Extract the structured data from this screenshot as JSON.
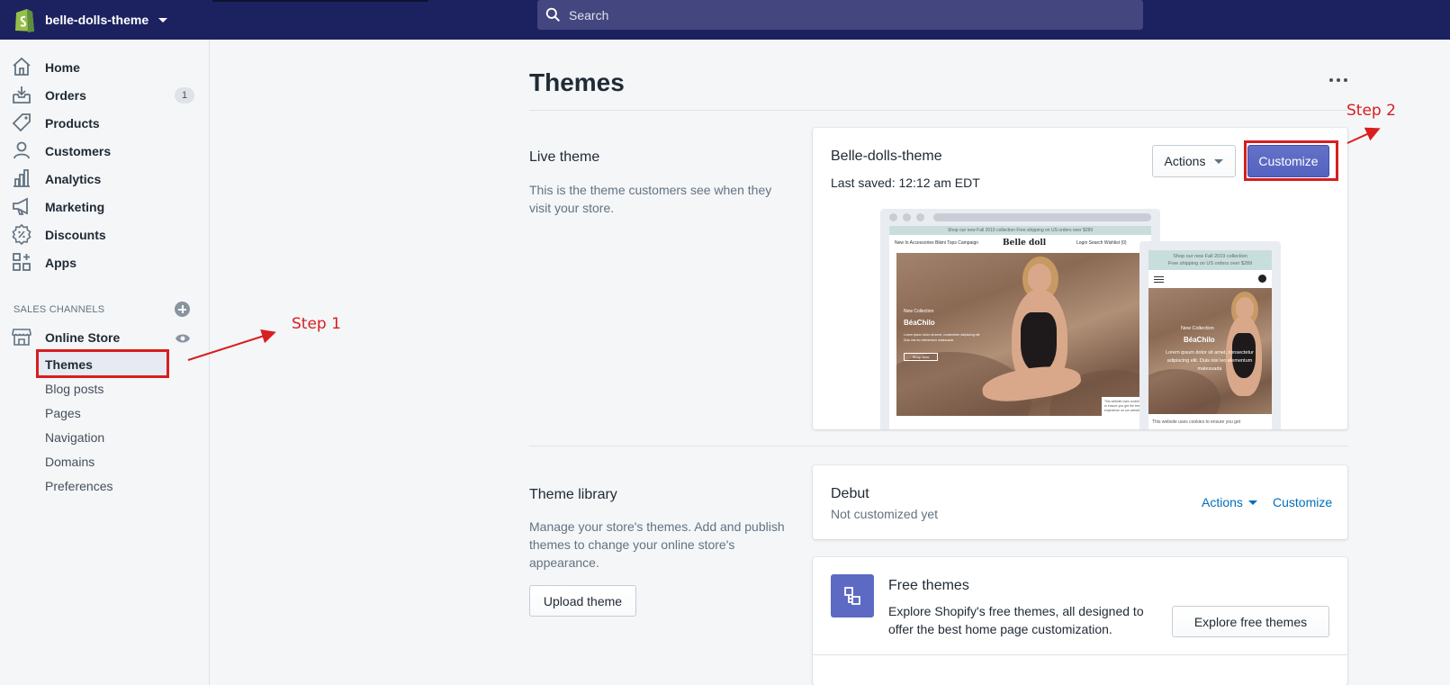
{
  "topbar": {
    "store_name": "belle-dolls-theme",
    "search_placeholder": "Search"
  },
  "sidebar": {
    "items": [
      {
        "label": "Home",
        "icon": "home-icon"
      },
      {
        "label": "Orders",
        "icon": "orders-icon",
        "badge": "1"
      },
      {
        "label": "Products",
        "icon": "tag-icon"
      },
      {
        "label": "Customers",
        "icon": "person-icon"
      },
      {
        "label": "Analytics",
        "icon": "bar-chart-icon"
      },
      {
        "label": "Marketing",
        "icon": "megaphone-icon"
      },
      {
        "label": "Discounts",
        "icon": "discount-icon"
      },
      {
        "label": "Apps",
        "icon": "apps-icon"
      }
    ],
    "sales_channels_title": "SALES CHANNELS",
    "online_store": "Online Store",
    "sub_items": [
      "Themes",
      "Blog posts",
      "Pages",
      "Navigation",
      "Domains",
      "Preferences"
    ]
  },
  "annotations": {
    "step1": "Step 1",
    "step2": "Step 2",
    "highlight_color": "#d81e1e"
  },
  "main": {
    "title": "Themes",
    "live_theme": {
      "heading": "Live theme",
      "description": "This is the theme customers see when they visit your store.",
      "card": {
        "name": "Belle-dolls-theme",
        "last_saved": "Last saved: 12:12 am EDT",
        "actions_label": "Actions",
        "customize_label": "Customize"
      },
      "preview": {
        "desktop_announcement": "Shop our new Fall 2019 collection  Free shipping on US orders over $289",
        "desktop_nav": "New In    Accessories    Bikini Tops    Campaign",
        "logo": "Belle doll",
        "desktop_right": "Login    Search    Wishlist (0)",
        "hero_small": "New Collection",
        "hero_big": "BéaChilo",
        "hero_body": "Lorem ipsum dolor sit amet, consectetur adipiscing elit. Duis nisi leo elementum malesuada",
        "hero_button": "Shop Now",
        "cookie_text": "This website uses cookies to ensure you get the best experience on our website.",
        "mobile_announcement_1": "Shop our new Fall 2019 collection",
        "mobile_announcement_2": "Free shipping on US orders over $289",
        "mobile_hero_small": "New Collection",
        "mobile_hero_big": "BéaChilo",
        "mobile_hero_body": "Lorem ipsum dolor sit amet, consectetur adipiscing elit. Duis nisi leo elementum malesuada",
        "mobile_cookie": "This website uses cookies to ensure you get"
      }
    },
    "library": {
      "heading": "Theme library",
      "description": "Manage your store's themes. Add and publish themes to change your online store's appearance.",
      "upload_label": "Upload theme",
      "debut": {
        "name": "Debut",
        "status": "Not customized yet",
        "actions_label": "Actions",
        "customize_label": "Customize"
      },
      "free": {
        "title": "Free themes",
        "description": "Explore Shopify's free themes, all designed to offer the best home page customization.",
        "button_label": "Explore free themes"
      }
    }
  }
}
